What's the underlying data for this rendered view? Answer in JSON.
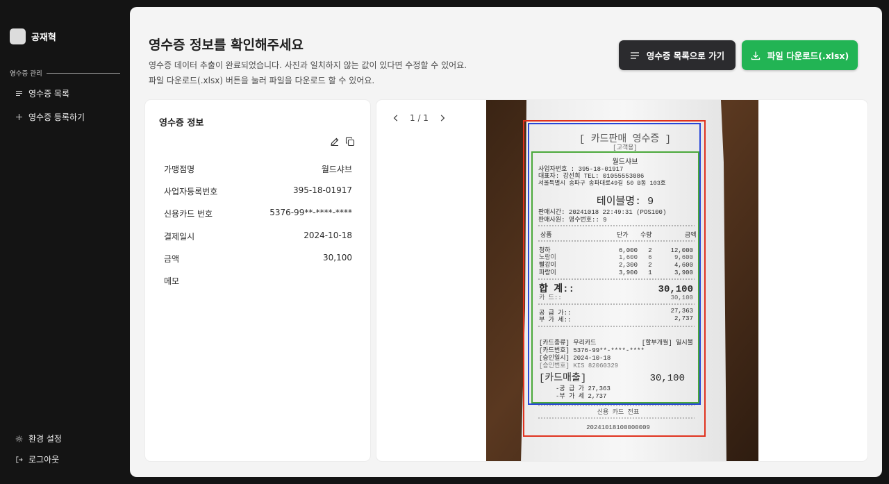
{
  "sidebar": {
    "user_name": "공재혁",
    "section_label": "영수증 관리",
    "nav": [
      {
        "label": "영수증 목록",
        "icon": "list-icon"
      },
      {
        "label": "영수증 등록하기",
        "icon": "plus-icon"
      }
    ],
    "footer": [
      {
        "label": "환경 설정",
        "icon": "gear-icon"
      },
      {
        "label": "로그아웃",
        "icon": "logout-icon"
      }
    ]
  },
  "header": {
    "title": "영수증 정보를 확인해주세요",
    "desc_line1": "영수증 데이터 추출이 완료되었습니다. 사진과 일치하지 않는 값이 있다면 수정할 수 있어요.",
    "desc_line2": "파일 다운로드(.xlsx) 버튼을 눌러 파일을 다운로드 할 수 있어요.",
    "list_button": "영수증 목록으로 가기",
    "download_button": "파일 다운로드(.xlsx)"
  },
  "info_card": {
    "title": "영수증 정보",
    "rows": [
      {
        "label": "가맹점명",
        "value": "월드샤브"
      },
      {
        "label": "사업자등록번호",
        "value": "395-18-01917"
      },
      {
        "label": "신용카드 번호",
        "value": "5376-99**-****-****"
      },
      {
        "label": "결제일시",
        "value": "2024-10-18"
      },
      {
        "label": "금액",
        "value": "30,100"
      },
      {
        "label": "메모",
        "value": ""
      }
    ]
  },
  "viewer": {
    "page_indicator": "1 / 1"
  },
  "receipt": {
    "header": "[ 카드판매 영수증 ]",
    "sub": "[고객용]",
    "store": "월드샤브",
    "biz_no": "사업자번호 : 395-18-01917",
    "ceo_tel": "대표자: 강선희     TEL: 01055553086",
    "address": "서울특별시 송파구 송파대로49길 50 B동 103호",
    "table": "테이블명: 9",
    "sale_time": "판매시간: 20241018 22:49:31  (POS100)",
    "sale_staff": "판매사원:    영수번호::  9",
    "col_item": "상품",
    "col_price": "단가",
    "col_qty": "수량",
    "col_amount": "금액",
    "items": [
      {
        "name": "청하",
        "price": "6,000",
        "qty": "2",
        "amount": "12,000"
      },
      {
        "name": "노랑이",
        "price": "1,600",
        "qty": "6",
        "amount": "9,600"
      },
      {
        "name": "빨강이",
        "price": "2,300",
        "qty": "2",
        "amount": "4,600"
      },
      {
        "name": "파랑이",
        "price": "3,900",
        "qty": "1",
        "amount": "3,900"
      }
    ],
    "total_label": "합    계::",
    "total_value": "30,100",
    "card_label": "카    드::",
    "card_value": "30,100",
    "supply_label": "공 급 가::",
    "supply_value": "27,363",
    "vat_label": "부 가 세::",
    "vat_value": "2,737",
    "card_type": "[카드종류] 우리카드",
    "installment": "[할부개월] 일시불",
    "card_no": "[카드번호]  5376-99**-****-****",
    "approval_date": "[승인일시]          2024-10-18",
    "approval_no": "[승인번호]    KIS    82060329",
    "card_sales_label": "[카드매출]",
    "card_sales_value": "30,100",
    "sales_supply": "-공 급 가      27,363",
    "sales_vat": "-부 가 세       2,737",
    "footer_title": "신용 카드 전표",
    "footer_no": "20241018100000009"
  },
  "colors": {
    "sidebar_bg": "#141414",
    "download_green": "#22b454",
    "list_button_dark": "#2b2b2e",
    "bbox_red": "#e0321e",
    "bbox_blue": "#2746d8",
    "bbox_green": "#4aa83a"
  }
}
